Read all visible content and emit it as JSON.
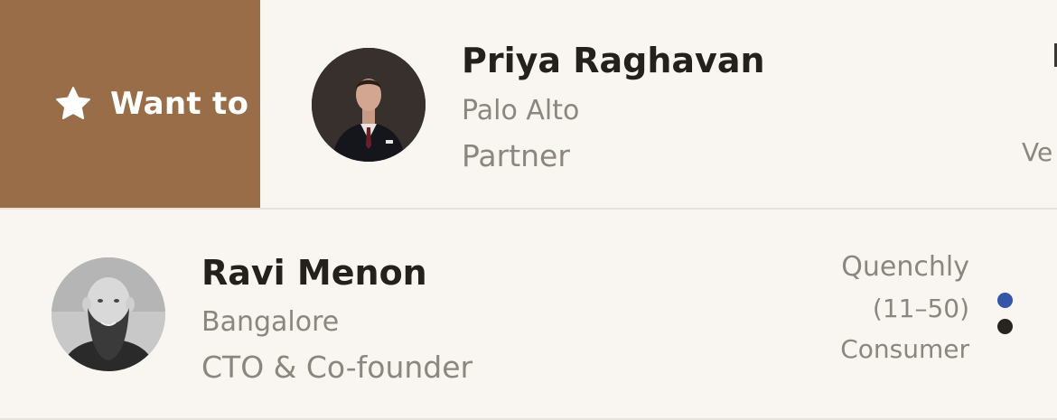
{
  "rows": [
    {
      "swipe_action": {
        "label": "Want to m",
        "icon": "star-icon"
      },
      "name": "Priya Raghavan",
      "city": "Palo Alto",
      "role": "Partner",
      "sector_partial": "Ve"
    },
    {
      "name": "Ravi Menon",
      "city": "Bangalore",
      "role": "CTO & Co-founder",
      "company": "Quenchly",
      "size": "(11–50)",
      "sector": "Consumer",
      "status_dots": [
        {
          "color": "#3556a6"
        },
        {
          "color": "#27231f"
        }
      ]
    }
  ],
  "colors": {
    "background": "#f9f6f1",
    "swipe_action": "#986d48",
    "primary_text": "#24211d",
    "secondary_text": "#8b867e"
  }
}
